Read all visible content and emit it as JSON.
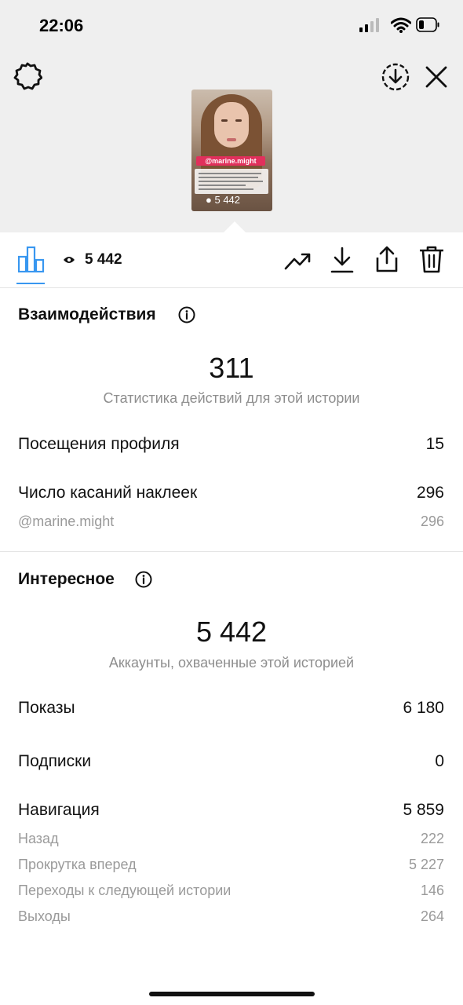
{
  "status_bar": {
    "time": "22:06"
  },
  "story_preview": {
    "username_tag": "@marine.might",
    "views_overlay": "5 442"
  },
  "toolbar": {
    "views": "5 442"
  },
  "interactions": {
    "title": "Взаимодействия",
    "total": "311",
    "caption": "Статистика действий для этой истории",
    "rows": [
      {
        "label": "Посещения профиля",
        "value": "15"
      },
      {
        "label": "Число касаний наклеек",
        "value": "296"
      }
    ],
    "sub_rows": [
      {
        "label": "@marine.might",
        "value": "296"
      }
    ]
  },
  "discovery": {
    "title": "Интересное",
    "total": "5 442",
    "caption": "Аккаунты, охваченные этой историей",
    "rows": [
      {
        "label": "Показы",
        "value": "6 180"
      },
      {
        "label": "Подписки",
        "value": "0"
      },
      {
        "label": "Навигация",
        "value": "5 859"
      }
    ],
    "navigation_sub": [
      {
        "label": "Назад",
        "value": "222"
      },
      {
        "label": "Прокрутка вперед",
        "value": "5 227"
      },
      {
        "label": "Переходы к следующей истории",
        "value": "146"
      },
      {
        "label": "Выходы",
        "value": "264"
      }
    ]
  },
  "colors": {
    "accent_blue": "#3897f0",
    "tag_red": "#e1305c",
    "muted_text": "#8e8e8e"
  },
  "icons": [
    "settings-gear-icon",
    "download-circle-icon",
    "close-icon",
    "bar-chart-icon",
    "eye-icon",
    "trending-icon",
    "download-icon",
    "share-icon",
    "trash-icon",
    "info-icon"
  ]
}
